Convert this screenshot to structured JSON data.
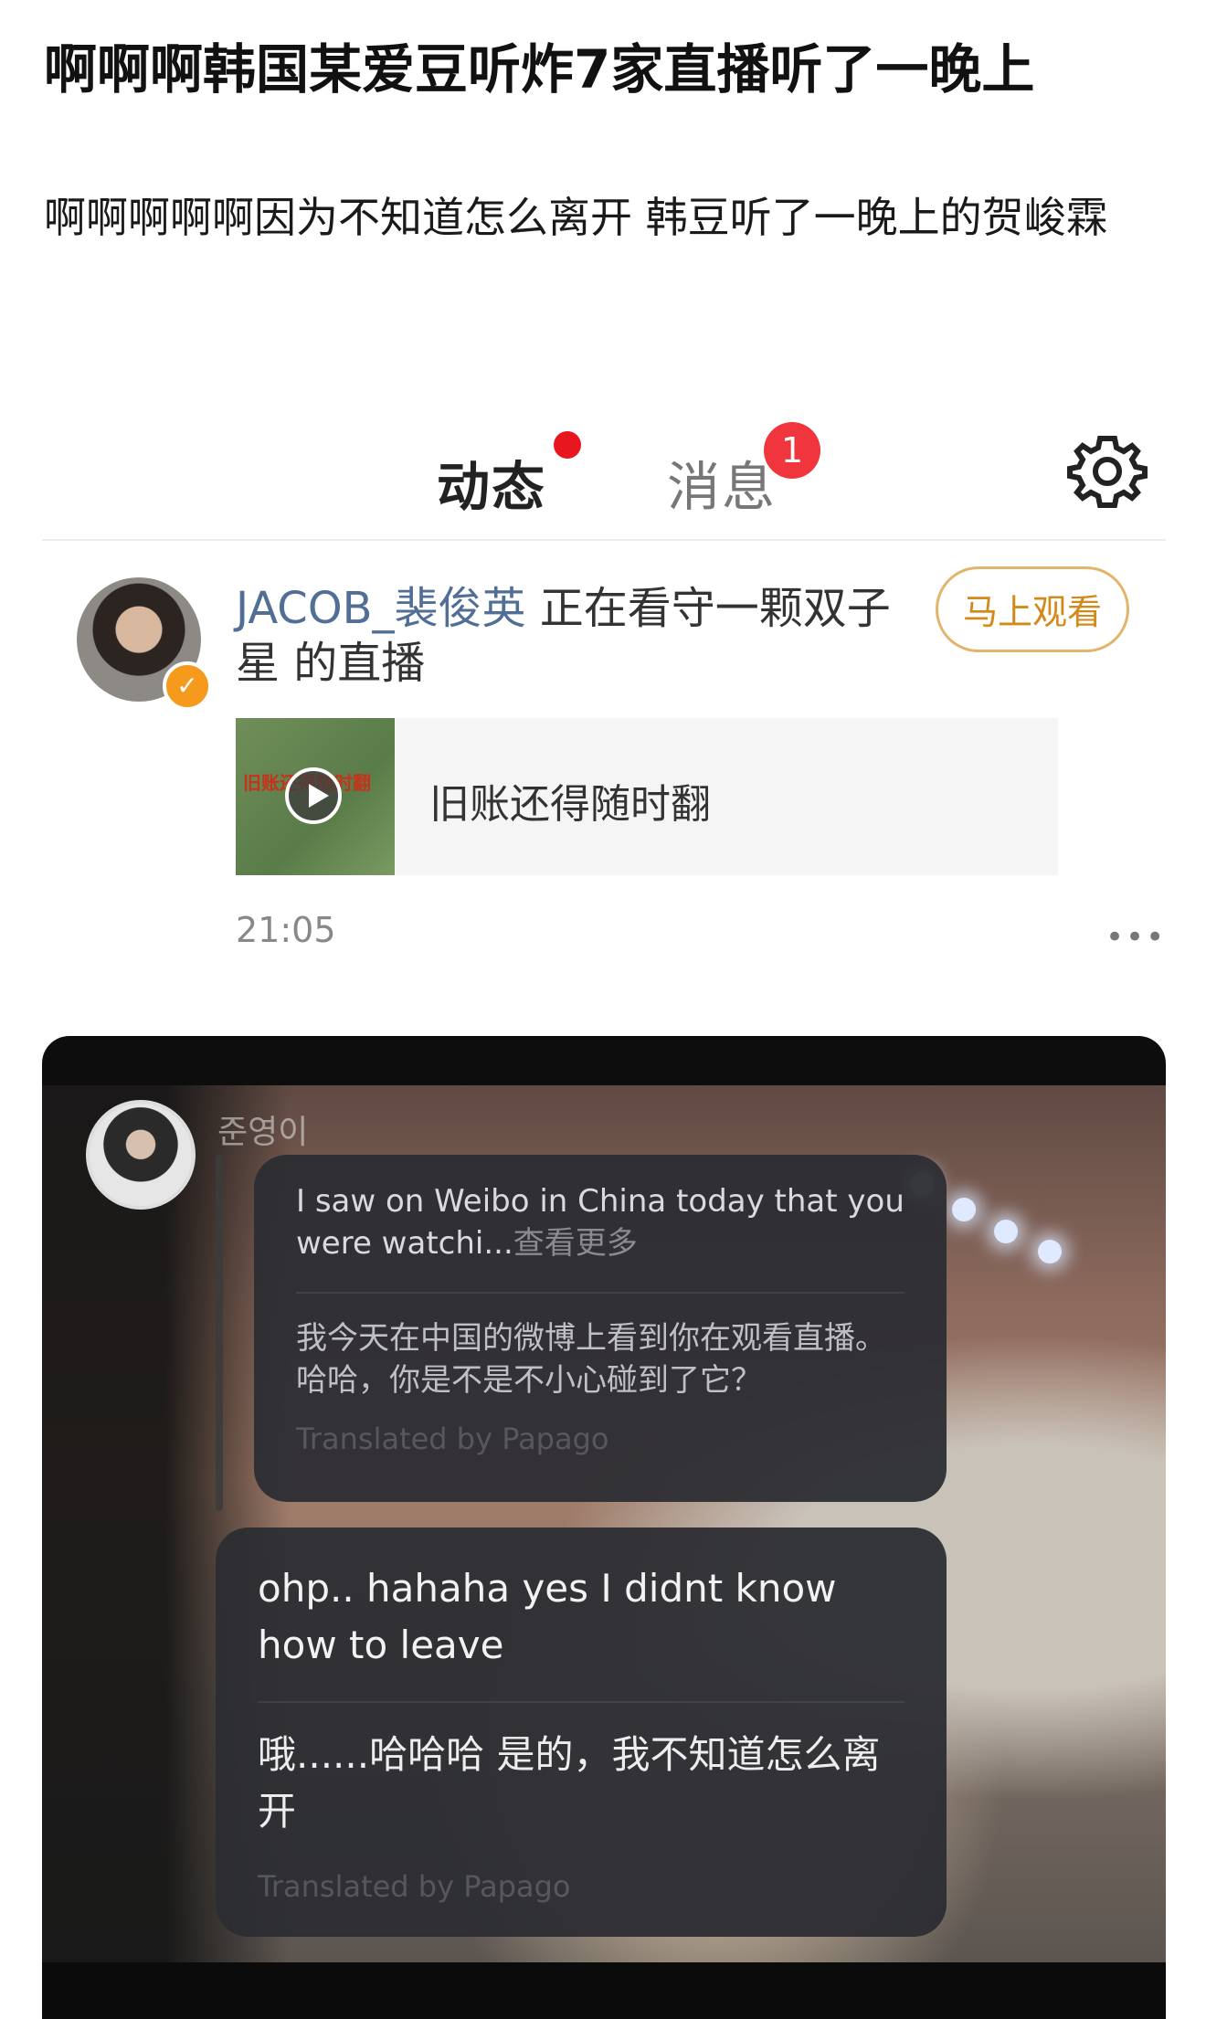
{
  "post": {
    "title": "啊啊啊韩国某爱豆听炸7家直播听了一晚上",
    "body": "啊啊啊啊啊因为不知道怎么离开 韩豆听了一晚上的贺峻霖"
  },
  "weibo_card": {
    "tabs": {
      "active": "动态",
      "messages": "消息",
      "messages_badge": "1"
    },
    "gear_icon": "gear-icon",
    "feed": {
      "username": "JACOB_裴俊英",
      "action": " 正在看守一颗双子星 的直播",
      "watch_button": "马上观看",
      "media_title": "旧账还得随时翻",
      "thumbnail_text": "旧账还得随时翻",
      "time": "21:05",
      "more_icon": "•••"
    },
    "accent_color": "#ffb400",
    "badge_color": "#f0353c"
  },
  "chat": {
    "sender": "준영이",
    "message1": {
      "original": "I saw on Weibo in China today that you were watchi...",
      "more_label": "查看更多",
      "translation": "我今天在中国的微博上看到你在观看直播。 哈哈，你是不是不小心碰到了它？",
      "credit": "Translated by Papago"
    },
    "message2": {
      "original": "ohp.. hahaha yes I didnt know how to leave",
      "translation": "哦......哈哈哈 是的，我不知道怎么离开",
      "credit": "Translated by Papago"
    }
  }
}
